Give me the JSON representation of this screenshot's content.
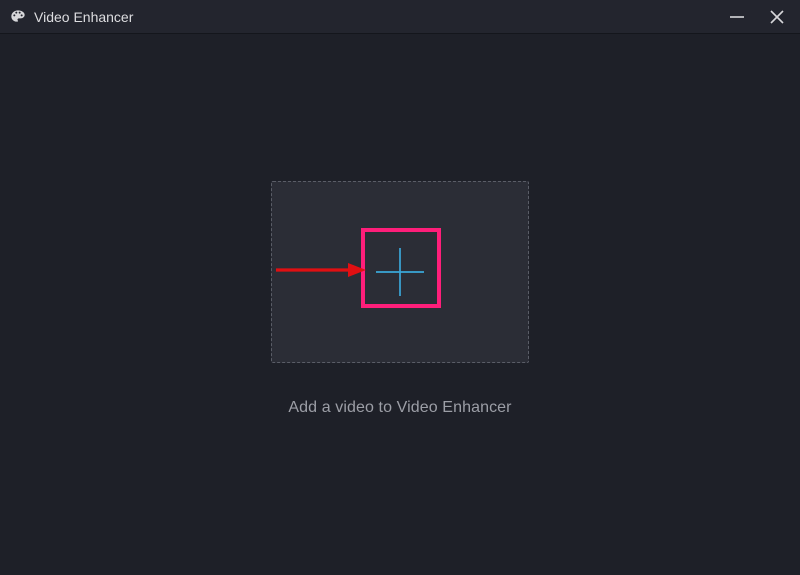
{
  "titlebar": {
    "app_title": "Video Enhancer"
  },
  "main": {
    "instruction": "Add a video to Video Enhancer"
  },
  "icons": {
    "app": "palette-icon",
    "minimize": "minimize-icon",
    "close": "close-icon",
    "plus": "plus-icon"
  },
  "colors": {
    "background": "#1e2028",
    "panel": "#2b2d36",
    "border_dashed": "#5a5d67",
    "plus_color": "#3aa7d9",
    "highlight_box": "#ff1e7a",
    "arrow": "#e10f12",
    "text_primary": "#cfcfd2",
    "text_secondary": "#9c9ea6"
  }
}
